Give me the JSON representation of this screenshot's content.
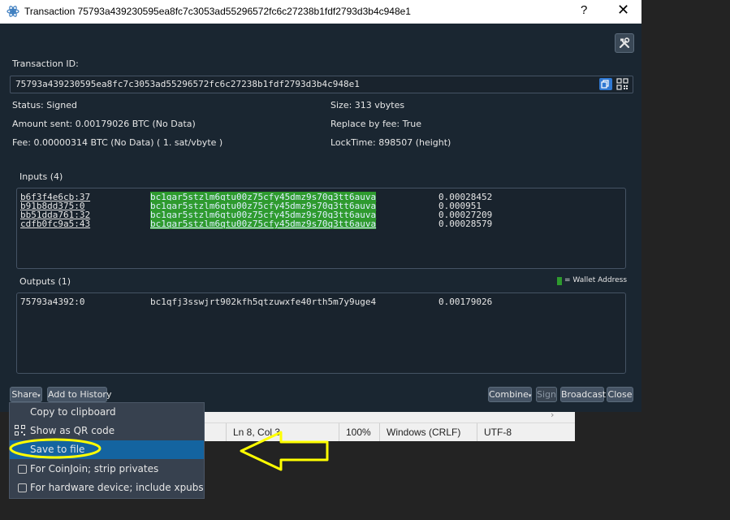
{
  "window": {
    "title": "Transaction 75793a439230595ea8fc7c3053ad55296572fc6c27238b1fdf2793d3b4c948e1",
    "help": "?",
    "close": "✕"
  },
  "txid": {
    "label": "Transaction ID:",
    "value": "75793a439230595ea8fc7c3053ad55296572fc6c27238b1fdf2793d3b4c948e1"
  },
  "details": {
    "status": "Status: Signed",
    "amount": "Amount sent: 0.00179026 BTC (No Data)",
    "fee": "Fee: 0.00000314 BTC (No Data)  ( 1. sat/vbyte )",
    "size": "Size: 313 vbytes",
    "rbf": "Replace by fee: True",
    "locktime": "LockTime: 898507 (height)"
  },
  "inputs": {
    "label": "Inputs (4)",
    "rows": [
      {
        "prevout": "b6f3f4e6cb:37",
        "address": "bc1qar5stzlm6qtu00z75cfy45dmz9s70q3tt6auva",
        "amount": "0.00028452"
      },
      {
        "prevout": "b91b8dd375:0",
        "address": "bc1qar5stzlm6qtu00z75cfy45dmz9s70q3tt6auva",
        "amount": "0.000951"
      },
      {
        "prevout": "bb51dda761:32",
        "address": "bc1qar5stzlm6qtu00z75cfy45dmz9s70q3tt6auva",
        "amount": "0.00027209"
      },
      {
        "prevout": "cdfb0fc9a5:43",
        "address": "bc1qar5stzlm6qtu00z75cfy45dmz9s70q3tt6auva",
        "amount": "0.00028579"
      }
    ]
  },
  "outputs": {
    "label": "Outputs (1)",
    "legend": "= Wallet Address",
    "rows": [
      {
        "outpoint": "75793a4392:0",
        "address": "bc1qfj3sswjrt902kfh5qtzuwxfe40rth5m7y9uge4",
        "amount": "0.00179026"
      }
    ]
  },
  "buttons": {
    "share": "Share",
    "add_history": "Add to History",
    "combine": "Combine",
    "sign": "Sign",
    "broadcast": "Broadcast",
    "close": "Close"
  },
  "share_menu": {
    "copy": "Copy to clipboard",
    "qr": "Show as QR code",
    "save": "Save to file",
    "coinjoin": "For CoinJoin; strip privates",
    "hardware": "For hardware device; include xpubs"
  },
  "background_status": {
    "position": "Ln 8, Col 3",
    "zoom": "100%",
    "eol": "Windows (CRLF)",
    "encoding": "UTF-8"
  },
  "colors": {
    "wallet_highlight": "#2e9a2e",
    "selection": "#1464a0",
    "annotation": "#ffff00"
  }
}
